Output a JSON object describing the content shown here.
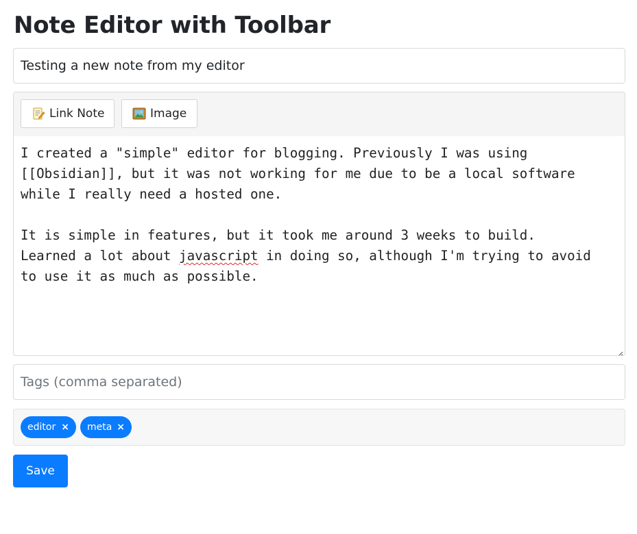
{
  "page": {
    "title": "Note Editor with Toolbar"
  },
  "title_field": {
    "value": "Testing a new note from my editor"
  },
  "toolbar": {
    "link_note_label": "Link Note",
    "link_note_icon": "memo-icon",
    "image_label": "Image",
    "image_icon": "framed-picture-icon"
  },
  "editor": {
    "line1": "I created a \"simple\" editor for blogging. Previously I was using\n[[Obsidian]], but it was not working for me due to be a local software\nwhile I really need a hosted one.\n\nIt is simple in features, but it took me around 3 weeks to build.\nLearned a lot about ",
    "misspelled_word": "javascript",
    "line2": " in doing so, although I'm trying to avoid\nto use it as much as possible."
  },
  "tags_field": {
    "placeholder": "Tags (comma separated)"
  },
  "tags": {
    "items": [
      {
        "label": "editor",
        "remove": "×"
      },
      {
        "label": "meta",
        "remove": "×"
      }
    ]
  },
  "actions": {
    "save_label": "Save"
  },
  "colors": {
    "accent": "#0a7cff",
    "toolbar_bg": "#f5f5f5",
    "tags_bg": "#f7f7f7",
    "border": "#d6d9dc",
    "spellcheck": "#e0282a"
  }
}
